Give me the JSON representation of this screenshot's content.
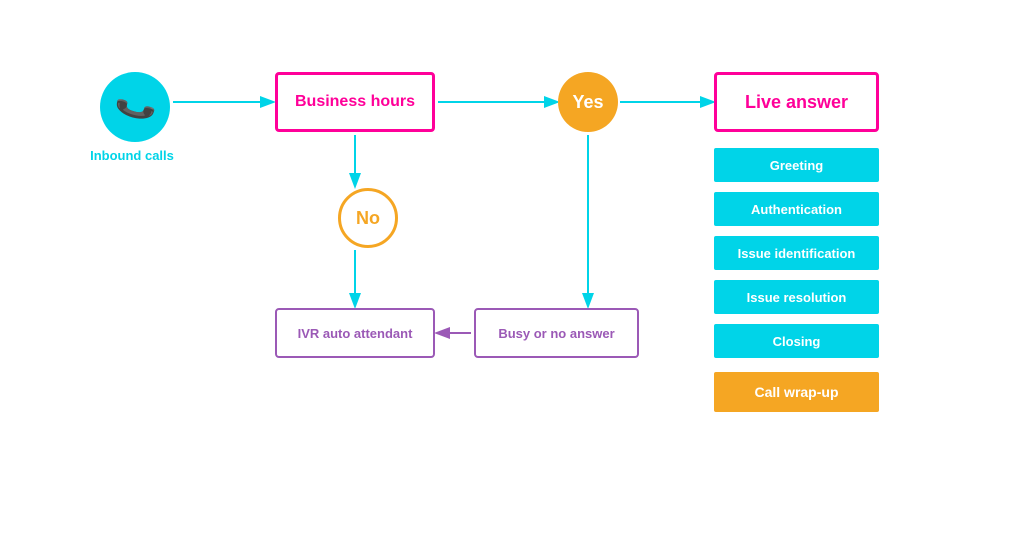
{
  "diagram": {
    "phone": {
      "label": "Inbound calls"
    },
    "business_hours": {
      "label": "Business hours"
    },
    "yes": {
      "label": "Yes"
    },
    "no": {
      "label": "No"
    },
    "live_answer": {
      "label": "Live answer"
    },
    "steps": [
      {
        "label": "Greeting"
      },
      {
        "label": "Authentication"
      },
      {
        "label": "Issue identification"
      },
      {
        "label": "Issue resolution"
      },
      {
        "label": "Closing"
      }
    ],
    "wrap_up": {
      "label": "Call wrap-up"
    },
    "ivr": {
      "label": "IVR auto attendant"
    },
    "busy": {
      "label": "Busy or no answer"
    }
  },
  "colors": {
    "cyan": "#00d4e8",
    "pink": "#ff0099",
    "orange": "#f5a623",
    "purple": "#9b59b6",
    "white": "#ffffff"
  }
}
